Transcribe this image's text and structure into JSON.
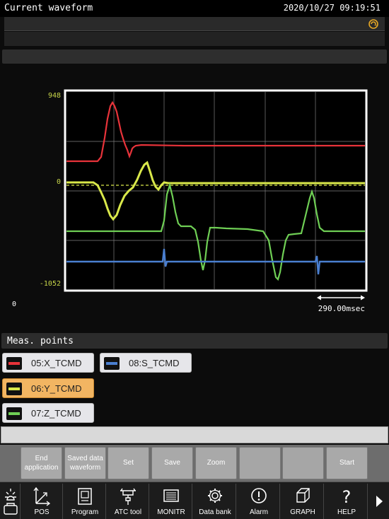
{
  "header": {
    "title": "Current waveform",
    "datetime": "2020/10/27  09:19:51"
  },
  "chart_data": {
    "type": "line",
    "y_axis_labels": {
      "top": "948",
      "zero": "0",
      "bottom": "-1052"
    },
    "x_origin_label": "0",
    "time_scale_label": "290.00msec",
    "grid": true,
    "series": [
      {
        "name": "05:X_TCMD",
        "color": "#e8333a"
      },
      {
        "name": "06:Y_TCMD",
        "color": "#d9e84a"
      },
      {
        "name": "07:Z_TCMD",
        "color": "#6fcf55"
      },
      {
        "name": "08:S_TCMD",
        "color": "#4a7fd0"
      }
    ]
  },
  "meas_points": {
    "header": "Meas. points",
    "items": [
      {
        "label": "05:X_TCMD",
        "color": "#e8333a"
      },
      {
        "label": "08:S_TCMD",
        "color": "#4a7fd0"
      },
      {
        "label": "06:Y_TCMD",
        "color": "#d9e84a",
        "selected": true
      },
      {
        "label": "07:Z_TCMD",
        "color": "#6fcf55"
      }
    ]
  },
  "softkeys": [
    {
      "label": "End application"
    },
    {
      "label": "Saved data waveform"
    },
    {
      "label": "Set"
    },
    {
      "label": "Save"
    },
    {
      "label": "Zoom"
    },
    {
      "label": ""
    },
    {
      "label": ""
    },
    {
      "label": "Start"
    }
  ],
  "menu": [
    {
      "label": "",
      "icon": "operator-icon"
    },
    {
      "label": "POS",
      "icon": "axes-icon"
    },
    {
      "label": "Program",
      "icon": "program-icon"
    },
    {
      "label": "ATC tool",
      "icon": "atc-tool-icon"
    },
    {
      "label": "MONITR",
      "icon": "monitor-icon"
    },
    {
      "label": "Data bank",
      "icon": "gear-icon"
    },
    {
      "label": "Alarm",
      "icon": "alarm-icon"
    },
    {
      "label": "GRAPH",
      "icon": "cube-icon"
    },
    {
      "label": "HELP",
      "icon": "help-icon"
    }
  ],
  "colors": {
    "accent": "#f2b562",
    "frame": "#ffffff",
    "axis_label": "#c8d64a"
  }
}
